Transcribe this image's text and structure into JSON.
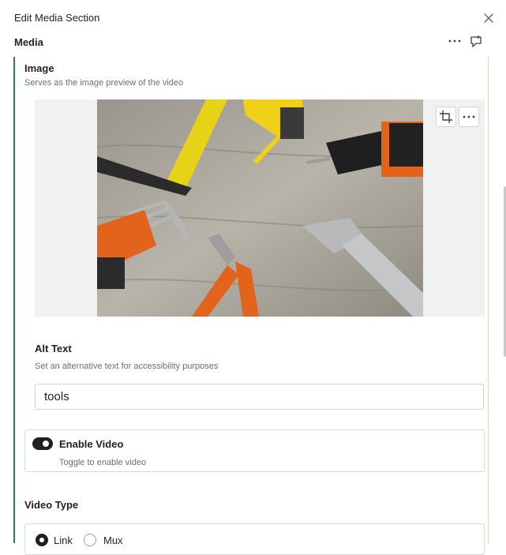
{
  "header": {
    "title": "Edit Media Section",
    "close_icon": "close-icon"
  },
  "section": {
    "label": "Media",
    "more_icon": "more-horizontal-icon",
    "comment_icon": "comment-icon"
  },
  "image_field": {
    "heading": "Image",
    "description": "Serves as the image preview of the video",
    "crop_icon": "crop-icon",
    "more_icon": "more-horizontal-icon"
  },
  "alt_text": {
    "heading": "Alt Text",
    "description": "Set an alternative text for accessibility purposes",
    "value": "tools"
  },
  "enable_video": {
    "label": "Enable Video",
    "description": "Toggle to enable video",
    "enabled": true
  },
  "video_type": {
    "heading": "Video Type",
    "options": [
      {
        "label": "Link",
        "selected": true
      },
      {
        "label": "Mux",
        "selected": false
      }
    ]
  },
  "colors": {
    "accent_rail": "#2e7a6b",
    "toggle_on": "#1f2024"
  }
}
